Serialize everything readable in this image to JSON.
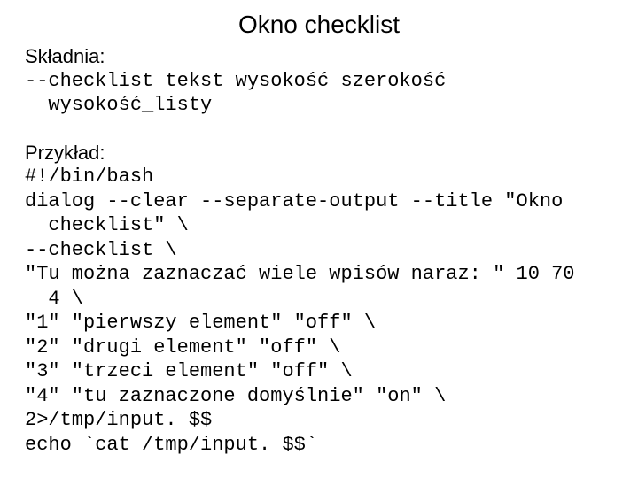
{
  "title": "Okno checklist",
  "syntax_label": "Składnia:",
  "syntax_code": "--checklist tekst wysokość szerokość\n  wysokość_listy",
  "example_label": "Przykład:",
  "example_code": "#!/bin/bash\ndialog --clear --separate-output --title \"Okno\n  checklist\" \\\n--checklist \\\n\"Tu można zaznaczać wiele wpisów naraz: \" 10 70\n  4 \\\n\"1\" \"pierwszy element\" \"off\" \\\n\"2\" \"drugi element\" \"off\" \\\n\"3\" \"trzeci element\" \"off\" \\\n\"4\" \"tu zaznaczone domyślnie\" \"on\" \\\n2>/tmp/input. $$\necho `cat /tmp/input. $$`"
}
